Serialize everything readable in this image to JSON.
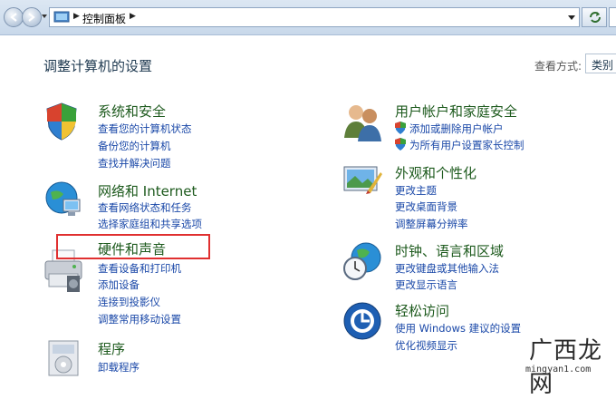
{
  "address_bar": {
    "breadcrumb": "控制面板"
  },
  "header": {
    "title": "调整计算机的设置",
    "view_label": "查看方式:",
    "view_value": "类别"
  },
  "categories": [
    {
      "title": "系统和安全",
      "icon": "shield-icon",
      "links": [
        "查看您的计算机状态",
        "备份您的计算机",
        "查找并解决问题"
      ]
    },
    {
      "title": "网络和 Internet",
      "icon": "network-globe-icon",
      "links": [
        "查看网络状态和任务",
        "选择家庭组和共享选项"
      ]
    },
    {
      "title": "硬件和声音",
      "icon": "printer-icon",
      "links": [
        "查看设备和打印机",
        "添加设备",
        "连接到投影仪",
        "调整常用移动设置"
      ]
    },
    {
      "title": "程序",
      "icon": "programs-icon",
      "links": [
        "卸载程序"
      ]
    },
    {
      "title": "用户帐户和家庭安全",
      "icon": "users-icon",
      "links": [
        "添加或删除用户帐户",
        "为所有用户设置家长控制"
      ]
    },
    {
      "title": "外观和个性化",
      "icon": "appearance-icon",
      "links": [
        "更改主题",
        "更改桌面背景",
        "调整屏幕分辨率"
      ]
    },
    {
      "title": "时钟、语言和区域",
      "icon": "clock-globe-icon",
      "links": [
        "更改键盘或其他输入法",
        "更改显示语言"
      ]
    },
    {
      "title": "轻松访问",
      "icon": "ease-of-access-icon",
      "links": [
        "使用 Windows 建议的设置",
        "优化视频显示"
      ]
    }
  ],
  "watermark": {
    "text": "广西龙网",
    "url": "mingyan1.com"
  },
  "colors": {
    "category_title": "#1d5a1d",
    "link": "#1a48a8",
    "highlight": "#e03030"
  }
}
